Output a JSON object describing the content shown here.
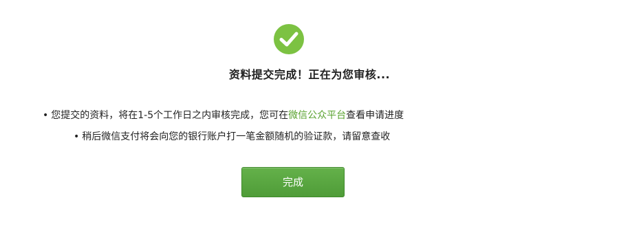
{
  "title": "资料提交完成！正在为您审核...",
  "notes": [
    {
      "bullet": "•",
      "text_before": "您提交的资料，将在1-5个工作日之内审核完成，您可在",
      "link": "微信公众平台",
      "text_after": "查看申请进度"
    },
    {
      "bullet": "•",
      "text": "稍后微信支付将会向您的银行账户打一笔金额随机的验证款，请留意查收"
    }
  ],
  "done_button": "完成",
  "colors": {
    "success": "#7cc242",
    "link": "#5aa330",
    "button": "#55a23c"
  },
  "icon": "check-circle-icon"
}
